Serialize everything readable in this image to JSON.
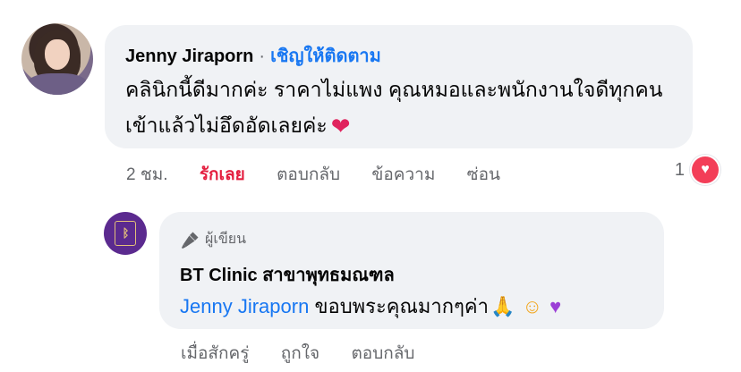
{
  "comment": {
    "author": "Jenny Jiraporn",
    "follow_label": "เชิญให้ติดตาม",
    "text": "คลินิกนี้ดีมากค่ะ ราคาไม่แพง คุณหมอและพนักงานใจดีทุกคน เข้าแล้วไม่อึดอัดเลยค่ะ",
    "time": "2 ชม.",
    "actions": {
      "like": "รักเลย",
      "reply": "ตอบกลับ",
      "message": "ข้อความ",
      "hide": "ซ่อน"
    },
    "reaction_count": "1"
  },
  "reply": {
    "badge": "ผู้เขียน",
    "author": "BT Clinic สาขาพุทธมณฑล",
    "mention": "Jenny Jiraporn",
    "text": "ขอบพระคุณมากๆค่า",
    "actions": {
      "time": "เมื่อสักครู่",
      "like": "ถูกใจ",
      "reply": "ตอบกลับ"
    }
  },
  "colors": {
    "bubble": "#f0f2f5",
    "link": "#1877f2",
    "liked": "#e41e3f",
    "muted": "#65676b"
  }
}
